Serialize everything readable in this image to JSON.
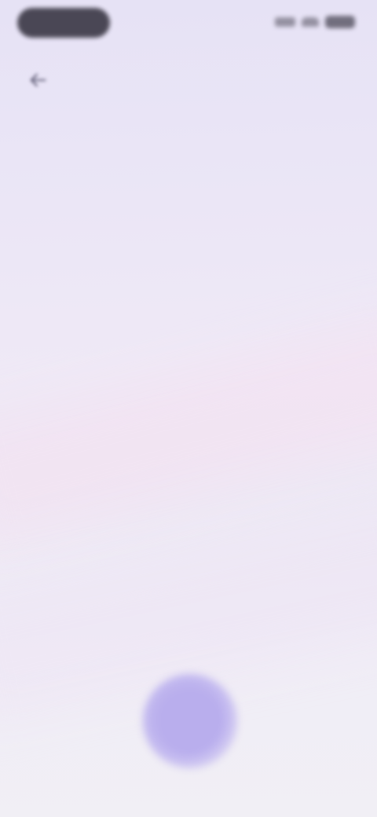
{
  "status_bar": {
    "icons": [
      "signal-icon",
      "wifi-icon",
      "battery-icon"
    ]
  },
  "navigation": {
    "back_icon": "arrow-left-icon"
  },
  "main": {
    "prompt_text": ""
  },
  "voice": {
    "mic_icon": "microphone-icon",
    "accent_color": "#b9aeed"
  },
  "colors": {
    "background_top": "#e6e2f5",
    "background_bottom": "#f1eff5"
  }
}
